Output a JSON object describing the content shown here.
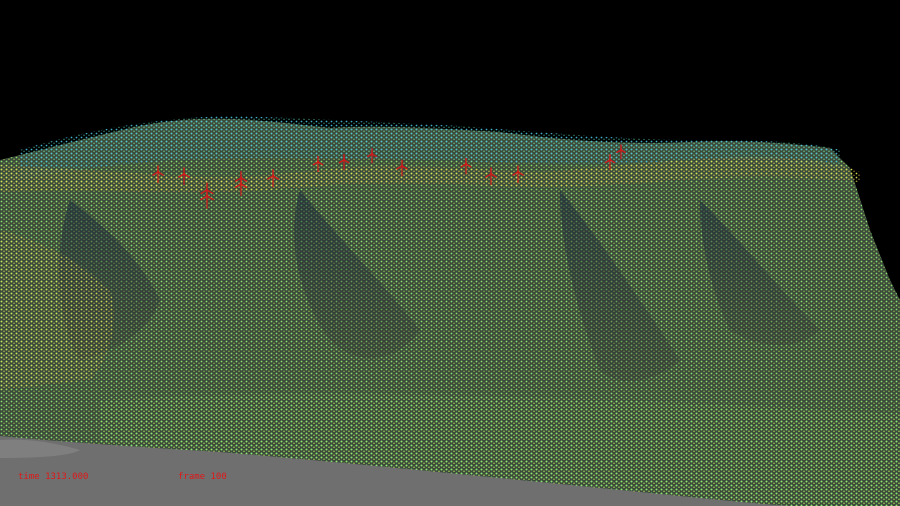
{
  "scene": {
    "background_color": "#000000",
    "ground_color": "#6f6f6f",
    "terrain_palette": [
      "#7ee87a",
      "#9ff064",
      "#d8e650",
      "#e8b94a",
      "#5ad0b8",
      "#3ab0e0",
      "#2f7fd8"
    ],
    "turbine_color": "#d01a1a",
    "turbine_count": 16
  },
  "hud": {
    "text_color": "#e01818",
    "time_label": "time 1313.000",
    "frame_label": "frame 100"
  }
}
